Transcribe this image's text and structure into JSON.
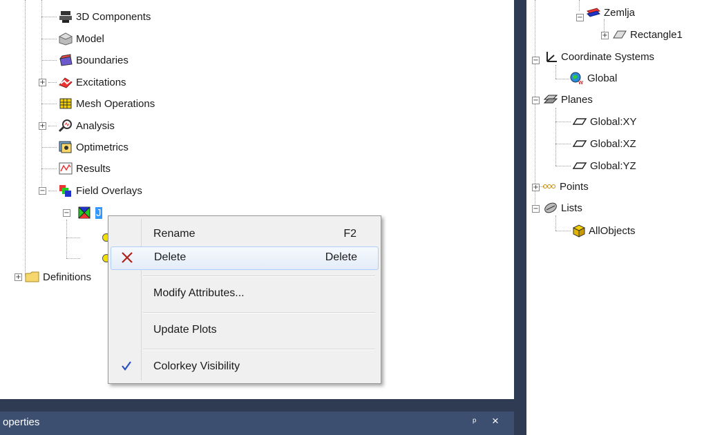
{
  "left_tree": {
    "items": [
      {
        "label": "3D Components",
        "icon": "3d-components-icon"
      },
      {
        "label": "Model",
        "icon": "model-icon"
      },
      {
        "label": "Boundaries",
        "icon": "boundaries-icon"
      },
      {
        "label": "Excitations",
        "icon": "excitations-icon"
      },
      {
        "label": "Mesh Operations",
        "icon": "mesh-operations-icon"
      },
      {
        "label": "Analysis",
        "icon": "analysis-icon"
      },
      {
        "label": "Optimetrics",
        "icon": "optimetrics-icon"
      },
      {
        "label": "Results",
        "icon": "results-icon"
      },
      {
        "label": "Field Overlays",
        "icon": "field-overlays-icon"
      }
    ],
    "selected_item_text": "J",
    "definitions_label": "Definitions"
  },
  "right_tree": {
    "items": [
      {
        "label": "Zemlja",
        "icon": "zemlja-icon"
      },
      {
        "label": "Rectangle1",
        "icon": "rectangle-icon"
      },
      {
        "label": "Coordinate Systems",
        "icon": "coordinate-systems-icon"
      },
      {
        "label": "Global",
        "icon": "globe-icon"
      },
      {
        "label": "Planes",
        "icon": "planes-icon"
      },
      {
        "label": "Global:XY",
        "icon": "plane-icon"
      },
      {
        "label": "Global:XZ",
        "icon": "plane-icon"
      },
      {
        "label": "Global:YZ",
        "icon": "plane-icon"
      },
      {
        "label": "Points",
        "icon": "points-icon"
      },
      {
        "label": "Lists",
        "icon": "lists-icon"
      },
      {
        "label": "AllObjects",
        "icon": "all-objects-icon"
      }
    ]
  },
  "context_menu": {
    "rename": {
      "label": "Rename",
      "shortcut": "F2"
    },
    "delete": {
      "label": "Delete",
      "shortcut": "Delete"
    },
    "modify": {
      "label": "Modify Attributes..."
    },
    "update": {
      "label": "Update Plots"
    },
    "colorkey": {
      "label": "Colorkey Visibility",
      "checked": true
    }
  },
  "properties_panel": {
    "title": "operties",
    "pin_glyph": "ᵖ",
    "close_glyph": "×"
  },
  "colors": {
    "splitter": "#2f3b52",
    "properties_tab": "#3d4f70",
    "menu_highlight": "#e3ecf8",
    "delete_icon": "#b0201a",
    "check": "#2a52be"
  }
}
